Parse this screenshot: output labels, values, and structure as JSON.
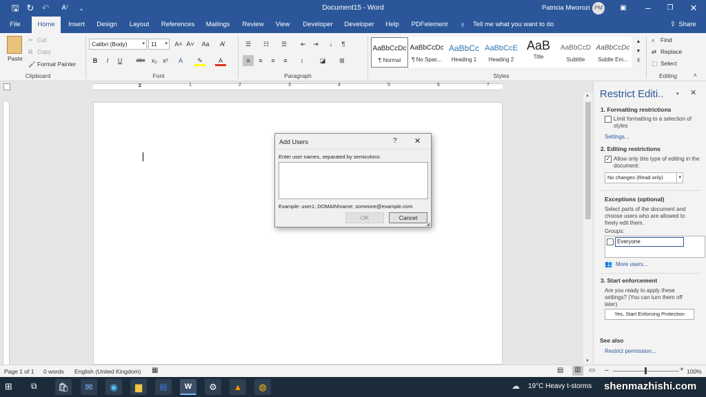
{
  "window": {
    "doc_title": "Document15 - Word",
    "user_name": "Patricia Mworozi",
    "user_initials": "PM"
  },
  "tabs": [
    "File",
    "Home",
    "Insert",
    "Design",
    "Layout",
    "References",
    "Mailings",
    "Review",
    "View",
    "Developer",
    "Developer",
    "Help",
    "PDFelement"
  ],
  "tell_me": "Tell me what you want to do",
  "share": "Share",
  "clipboard": {
    "paste": "Paste",
    "cut": "Cut",
    "copy": "Copy",
    "format_painter": "Format Painter",
    "group": "Clipboard"
  },
  "font": {
    "name": "Calibri (Body)",
    "size": "11",
    "group": "Font"
  },
  "paragraph": {
    "group": "Paragraph"
  },
  "styles": {
    "group": "Styles",
    "items": [
      {
        "preview": "AaBbCcDc",
        "name": "¶ Normal"
      },
      {
        "preview": "AaBbCcDc",
        "name": "¶ No Spac..."
      },
      {
        "preview": "AaBbCc",
        "name": "Heading 1"
      },
      {
        "preview": "AaBbCcE",
        "name": "Heading 2"
      },
      {
        "preview": "AaB",
        "name": "Title"
      },
      {
        "preview": "AaBbCcD",
        "name": "Subtitle"
      },
      {
        "preview": "AaBbCcDc",
        "name": "Subtle Em..."
      }
    ]
  },
  "editing": {
    "find": "Find",
    "replace": "Replace",
    "select": "Select",
    "group": "Editing"
  },
  "ruler_numbers": [
    "1",
    "2",
    "3",
    "4",
    "5",
    "6",
    "7"
  ],
  "pane": {
    "title": "Restrict Editi..",
    "s1_heading": "1. Formatting restrictions",
    "s1_checkbox": "Limit formatting to a selection of styles",
    "s1_link": "Settings...",
    "s2_heading": "2. Editing restrictions",
    "s2_checkbox": "Allow only this type of editing in the document:",
    "s2_select": "No changes (Read only)",
    "exc_heading": "Exceptions (optional)",
    "exc_desc": "Select parts of the document and choose users who are allowed to freely edit them.",
    "groups_label": "Groups:",
    "group_item": "Everyone",
    "more_users": "More users...",
    "s3_heading": "3. Start enforcement",
    "s3_desc": "Are you ready to apply these settings? (You can turn them off later)",
    "s3_button": "Yes, Start Enforcing Protection",
    "see_also": "See also",
    "restrict_permission": "Restrict permission..."
  },
  "dialog": {
    "title": "Add Users",
    "help": "?",
    "prompt": "Enter user names, separated by semicolons:",
    "input_value": "",
    "example": "Example: user1; DOMAIN\\name; someone@example.com",
    "ok": "OK",
    "cancel": "Cancel"
  },
  "status": {
    "page": "Page 1 of 1",
    "words": "0 words",
    "language": "English (United Kingdom)",
    "zoom": "100%"
  },
  "taskbar": {
    "weather": "19°C  Heavy t-storms",
    "watermark": "shenmazhishi.com"
  },
  "colors": {
    "accent": "#2b579a",
    "taskbar": "#1c2b3a"
  }
}
